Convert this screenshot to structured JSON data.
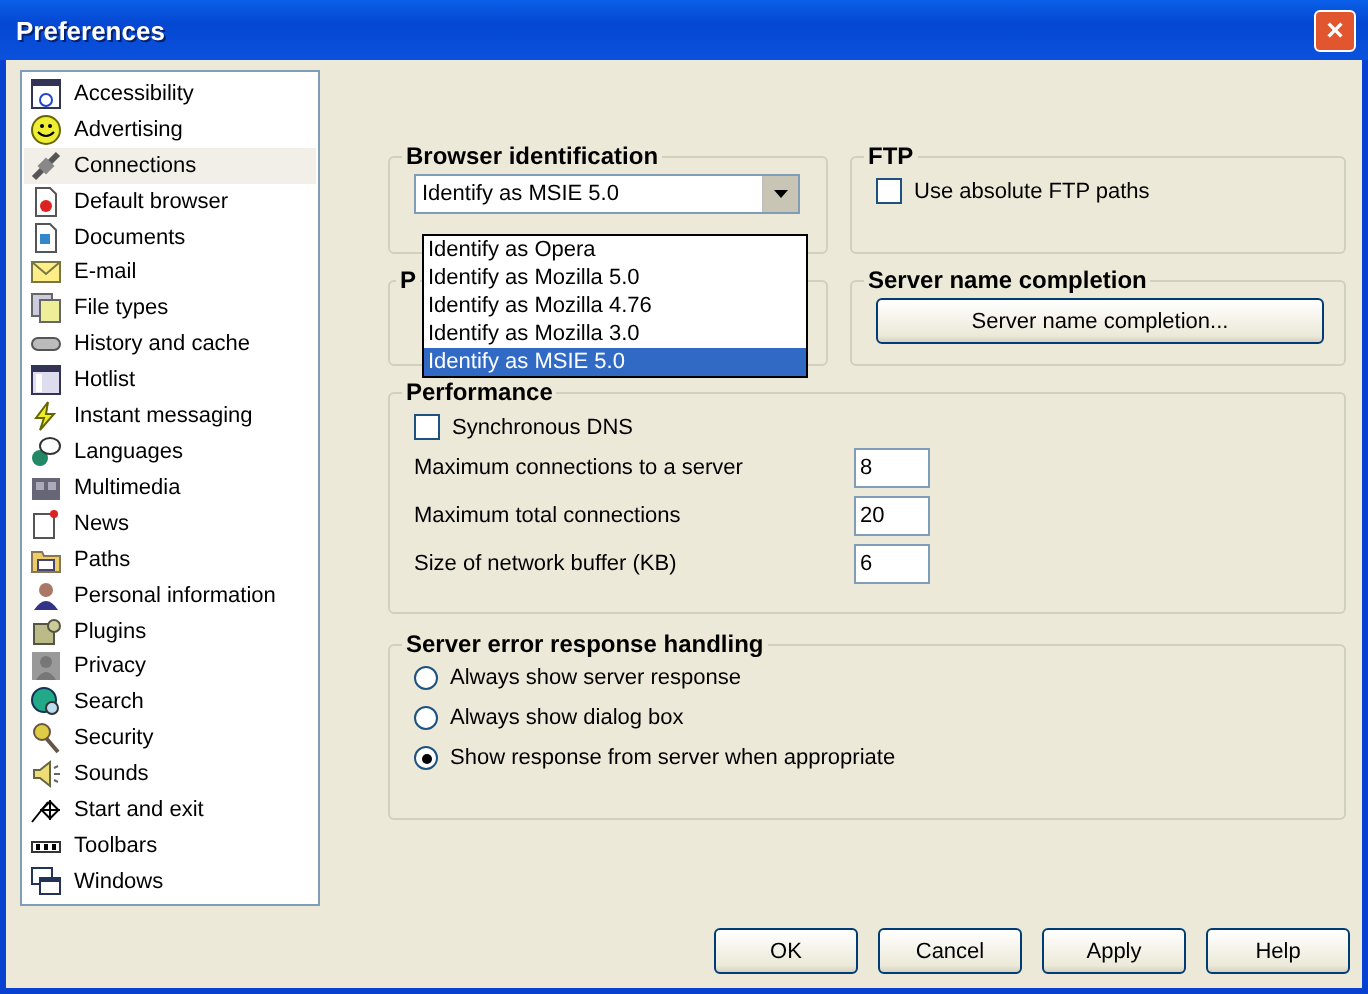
{
  "window": {
    "title": "Preferences",
    "close": "×"
  },
  "sidebar": {
    "items": [
      {
        "label": "Accessibility",
        "selected": false
      },
      {
        "label": "Advertising",
        "selected": false
      },
      {
        "label": "Connections",
        "selected": true
      },
      {
        "label": "Default browser",
        "selected": false
      },
      {
        "label": "Documents",
        "selected": false
      },
      {
        "label": "E-mail",
        "selected": false
      },
      {
        "label": "File types",
        "selected": false
      },
      {
        "label": "History and cache",
        "selected": false
      },
      {
        "label": "Hotlist",
        "selected": false
      },
      {
        "label": "Instant messaging",
        "selected": false
      },
      {
        "label": "Languages",
        "selected": false
      },
      {
        "label": "Multimedia",
        "selected": false
      },
      {
        "label": "News",
        "selected": false
      },
      {
        "label": "Paths",
        "selected": false
      },
      {
        "label": "Personal information",
        "selected": false
      },
      {
        "label": "Plugins",
        "selected": false
      },
      {
        "label": "Privacy",
        "selected": false
      },
      {
        "label": "Search",
        "selected": false
      },
      {
        "label": "Security",
        "selected": false
      },
      {
        "label": "Sounds",
        "selected": false
      },
      {
        "label": "Start and exit",
        "selected": false
      },
      {
        "label": "Toolbars",
        "selected": false
      },
      {
        "label": "Windows",
        "selected": false
      }
    ]
  },
  "browser_identification": {
    "title": "Browser identification",
    "value": "Identify as MSIE 5.0",
    "expanded": true,
    "options": [
      {
        "label": "Identify as Opera",
        "selected": false
      },
      {
        "label": "Identify as Mozilla 5.0",
        "selected": false
      },
      {
        "label": "Identify as Mozilla 4.76",
        "selected": false
      },
      {
        "label": "Identify as Mozilla 3.0",
        "selected": false
      },
      {
        "label": "Identify as MSIE 5.0",
        "selected": true
      }
    ]
  },
  "ftp": {
    "title": "FTP",
    "checkbox": {
      "label": "Use absolute FTP paths",
      "checked": false
    }
  },
  "hidden_group": {
    "title": "P"
  },
  "server_name_completion": {
    "title": "Server name completion",
    "button": "Server name completion..."
  },
  "performance": {
    "title": "Performance",
    "checkbox": {
      "label": "Synchronous DNS",
      "checked": false
    },
    "fields": [
      {
        "label": "Maximum connections to a server",
        "value": "8"
      },
      {
        "label": "Maximum total connections",
        "value": "20"
      },
      {
        "label": "Size of network buffer (KB)",
        "value": "6"
      }
    ]
  },
  "server_error": {
    "title": "Server error response handling",
    "options": [
      {
        "label": "Always show server response",
        "selected": false
      },
      {
        "label": "Always show dialog box",
        "selected": false
      },
      {
        "label": "Show response from server when appropriate",
        "selected": true
      }
    ]
  },
  "buttons": [
    "OK",
    "Cancel",
    "Apply",
    "Help"
  ]
}
